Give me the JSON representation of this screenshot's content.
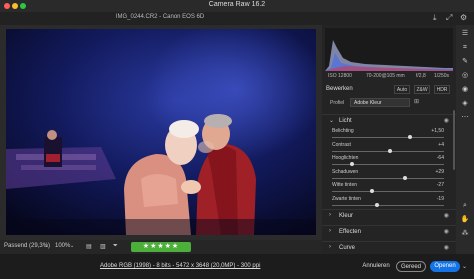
{
  "window": {
    "title": "Camera Raw 16.2",
    "file_info": "IMG_0244.CR2  -  Canon EOS 6D"
  },
  "canvas": {
    "zoom_mode": "Passend (29,3%)",
    "zoom_level": "100%",
    "rating": "★★★★★"
  },
  "exif": {
    "iso": "ISO 12800",
    "lens": "70-200@105 mm",
    "aperture": "f/2,8",
    "shutter": "1/250s"
  },
  "panel": {
    "heading": "Bewerken",
    "tabs": [
      {
        "label": "Auto"
      },
      {
        "label": "Z&W"
      },
      {
        "label": "HDR"
      }
    ],
    "profile_label": "Profiel",
    "profile_value": "Adobe Kleur",
    "section_licht": "Licht",
    "sliders": [
      {
        "label": "Belichting",
        "value": "+1,50",
        "position": 0.7
      },
      {
        "label": "Contrast",
        "value": "+4",
        "position": 0.52
      },
      {
        "label": "Hooglichten",
        "value": "-64",
        "position": 0.18
      },
      {
        "label": "Schaduwen",
        "value": "+29",
        "position": 0.65
      },
      {
        "label": "Witte tinten",
        "value": "-27",
        "position": 0.36
      },
      {
        "label": "Zwarte tinten",
        "value": "-19",
        "position": 0.4
      }
    ],
    "sections": [
      {
        "label": "Kleur"
      },
      {
        "label": "Effecten"
      },
      {
        "label": "Curve"
      }
    ]
  },
  "footer": {
    "workflow": "Adobe RGB (1998) - 8 bits - 5472 x 3648 (20,0MP) - 300 ppi",
    "cancel_label": "Annuleren",
    "done_label": "Gereed",
    "open_label": "Openen"
  },
  "colors": {
    "accent": "#1473e6",
    "rating_bg": "#4caf3a"
  }
}
